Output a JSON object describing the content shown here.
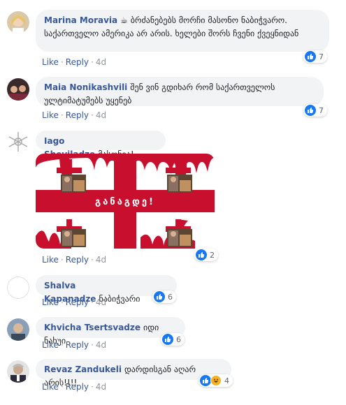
{
  "comments": [
    {
      "author": "Marina Moravia",
      "text": "☕ ბრძანებებს მორჩი მასონო ნაბიჭვარო. საქართველო ამერიკა არ არის. ხელები შორს ჩვენი ქვეყნიდან",
      "like": "Like",
      "reply": "Reply",
      "time": "4d",
      "reactions": "7"
    },
    {
      "author": "Maia Nonikashvili",
      "text": "შენ ვინ გდიხარ რომ საქართველოს ულტიმატუმებს უყენებ",
      "like": "Like",
      "reply": "Reply",
      "time": "4d",
      "reactions": "7"
    },
    {
      "author": "Iago Sheyiladze",
      "text": "მასონია!...",
      "like": "Like",
      "reply": "Reply",
      "time": "4d",
      "reactions": "2",
      "image_caption": "განაგდე!"
    },
    {
      "author": "Shalva Kapanadze",
      "text": "ნაბიჭვარი",
      "like": "Like",
      "reply": "Reply",
      "time": "4d",
      "reactions": "6"
    },
    {
      "author": "Khvicha Tsertsvadze",
      "text": "იდი ნახუი",
      "like": "Like",
      "reply": "Reply",
      "time": "4d",
      "reactions": "6"
    },
    {
      "author": "Revaz Zandukeli",
      "text": "დარდისგან აღარ არის!!!!",
      "like": "Like",
      "reply": "Reply",
      "time": "4d",
      "reactions": "4"
    }
  ],
  "colors": {
    "link": "#385898",
    "bubble": "#f2f3f5",
    "like": "#1877f2",
    "flag_red": "#c8102e"
  }
}
